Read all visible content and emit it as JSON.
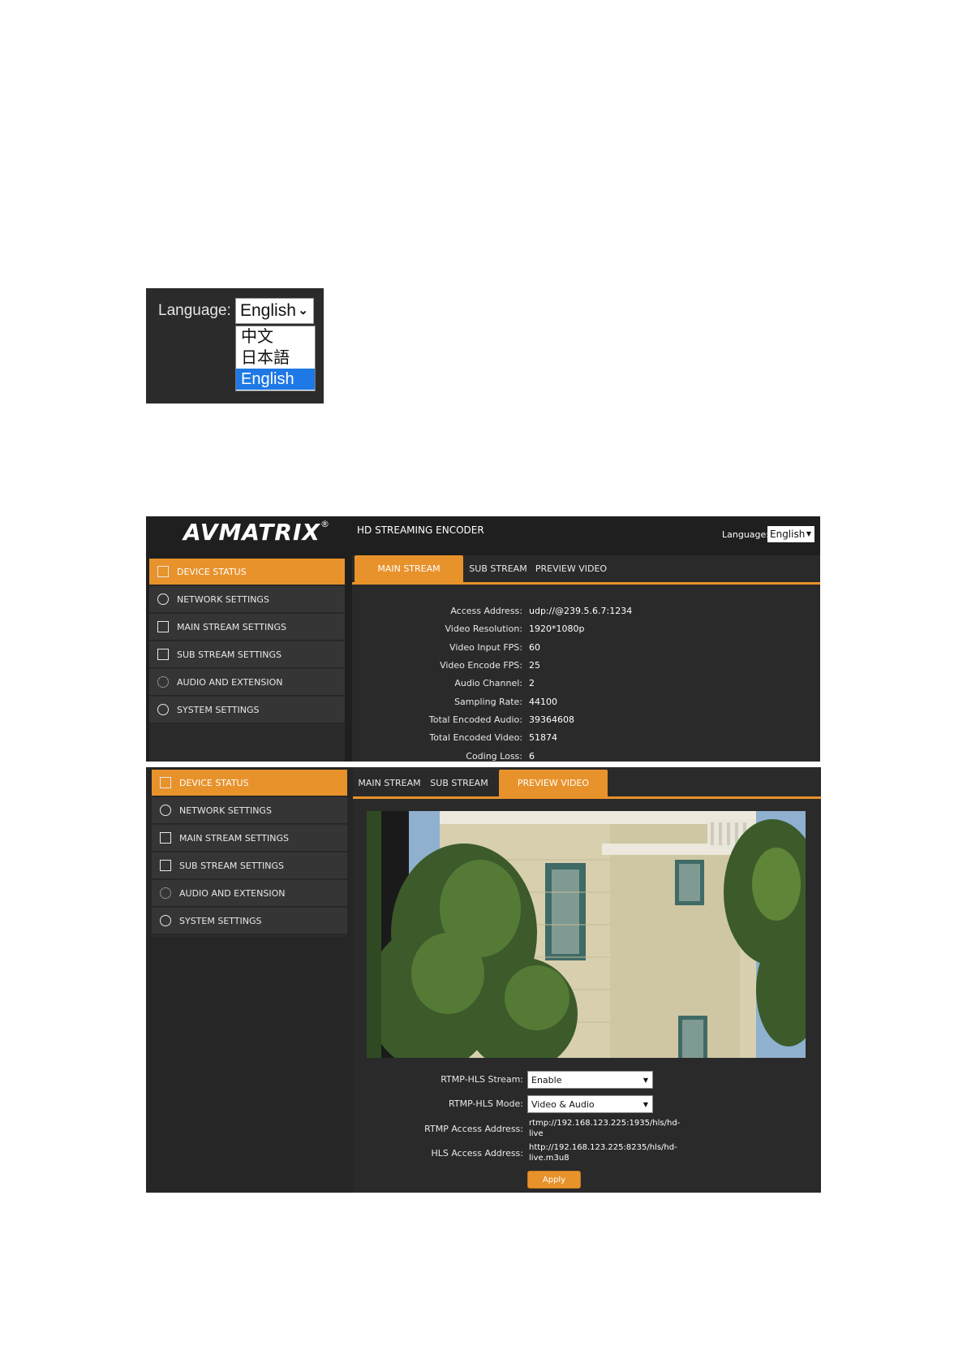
{
  "language_crop": {
    "label": "Language:",
    "selected": "English",
    "options": [
      "中文",
      "日本語",
      "English"
    ]
  },
  "header": {
    "logo": "AVMATRIX",
    "logo_mark": "®",
    "title": "HD STREAMING ENCODER",
    "language_label": "Language:",
    "language_value": "English"
  },
  "sidebar": {
    "items": [
      {
        "label": "DEVICE STATUS",
        "icon": "monitor-icon"
      },
      {
        "label": "NETWORK SETTINGS",
        "icon": "globe-icon"
      },
      {
        "label": "MAIN STREAM SETTINGS",
        "icon": "stream-icon"
      },
      {
        "label": "SUB STREAM SETTINGS",
        "icon": "stream-icon"
      },
      {
        "label": "AUDIO AND EXTENSION",
        "icon": "gear-dots-icon"
      },
      {
        "label": "SYSTEM SETTINGS",
        "icon": "gear-icon"
      }
    ]
  },
  "tabs": [
    "MAIN STREAM",
    "SUB STREAM",
    "PREVIEW VIDEO"
  ],
  "status": {
    "rows": [
      {
        "label": "Access Address:",
        "value": "udp://@239.5.6.7:1234"
      },
      {
        "label": "Video Resolution:",
        "value": "1920*1080p"
      },
      {
        "label": "Video Input FPS:",
        "value": "60"
      },
      {
        "label": "Video Encode FPS:",
        "value": "25"
      },
      {
        "label": "Audio Channel:",
        "value": "2"
      },
      {
        "label": "Sampling Rate:",
        "value": "44100"
      },
      {
        "label": "Total Encoded Audio:",
        "value": "39364608"
      },
      {
        "label": "Total Encoded Video:",
        "value": "51874"
      },
      {
        "label": "Coding Loss:",
        "value": "6"
      }
    ]
  },
  "preview": {
    "rtmp_hls_stream_label": "RTMP-HLS Stream:",
    "rtmp_hls_stream_value": "Enable",
    "rtmp_hls_mode_label": "RTMP-HLS Mode:",
    "rtmp_hls_mode_value": "Video & Audio",
    "rtmp_address_label": "RTMP Access Address:",
    "rtmp_address_line1": "rtmp://192.168.123.225:1935/hls/hd-",
    "rtmp_address_line2": "live",
    "hls_address_label": "HLS Access Address:",
    "hls_address_line1": "http://192.168.123.225:8235/hls/hd-",
    "hls_address_line2": "live.m3u8",
    "apply_label": "Apply"
  },
  "colors": {
    "accent": "#e8922b",
    "panel": "#2a2a2a",
    "sidebar_item": "#353535",
    "dropdown_highlight": "#1e78e6"
  }
}
